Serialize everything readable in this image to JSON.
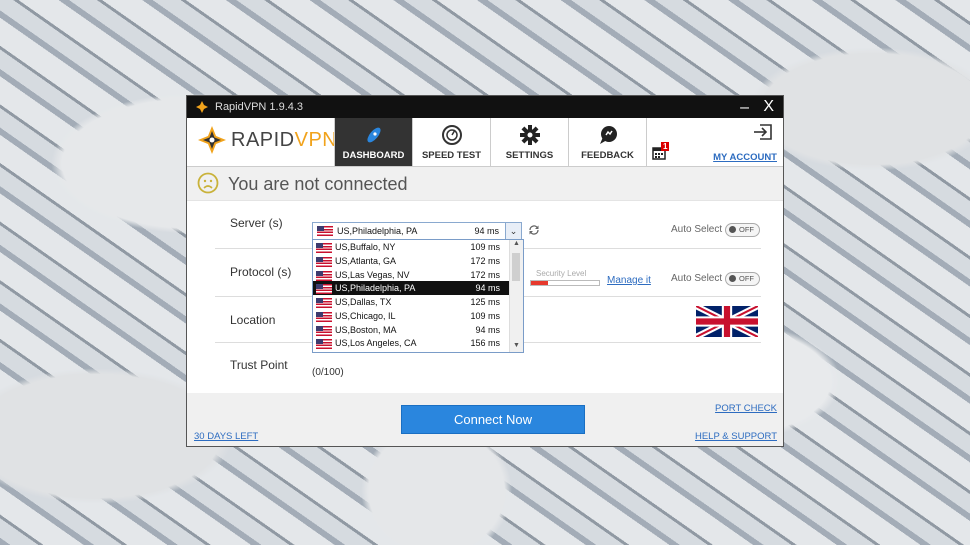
{
  "window": {
    "title": "RapidVPN 1.9.4.3",
    "minimize": "–",
    "close": "X"
  },
  "brand": {
    "part1": "RAPID",
    "part2": "VPN"
  },
  "nav": {
    "items": [
      {
        "label": "DASHBOARD",
        "icon": "rocket-icon",
        "active": true
      },
      {
        "label": "SPEED TEST",
        "icon": "speedometer-icon"
      },
      {
        "label": "SETTINGS",
        "icon": "gear-icon"
      },
      {
        "label": "FEEDBACK",
        "icon": "chat-bubble-icon"
      }
    ],
    "calendar_badge": "1",
    "my_account": "MY ACCOUNT"
  },
  "status": {
    "text": "You are not connected",
    "icon": "sad-face-icon"
  },
  "rows": {
    "server_label": "Server (s)",
    "protocol_label": "Protocol (s)",
    "location_label": "Location",
    "trust_label": "Trust Point",
    "trust_value": "(0/100)"
  },
  "server_select": {
    "name": "US,Philadelphia, PA",
    "ms": "94 ms"
  },
  "auto_select": {
    "label": "Auto Select",
    "state": "OFF"
  },
  "security": {
    "label": "Security Level",
    "level": 0.25,
    "manage": "Manage it"
  },
  "dropdown": {
    "items": [
      {
        "name": "US,Buffalo, NY",
        "ms": "109 ms"
      },
      {
        "name": "US,Atlanta, GA",
        "ms": "172 ms"
      },
      {
        "name": "US,Las Vegas, NV",
        "ms": "172 ms"
      },
      {
        "name": "US,Philadelphia, PA",
        "ms": "94 ms",
        "selected": true
      },
      {
        "name": "US,Dallas, TX",
        "ms": "125 ms"
      },
      {
        "name": "US,Chicago, IL",
        "ms": "109 ms"
      },
      {
        "name": "US,Boston, MA",
        "ms": "94 ms"
      },
      {
        "name": "US,Los Angeles, CA",
        "ms": "156 ms"
      }
    ]
  },
  "footer": {
    "connect": "Connect Now",
    "days_left": "30 DAYS LEFT",
    "port_check": "PORT CHECK",
    "help": "HELP & SUPPORT"
  },
  "colors": {
    "accent": "#2a86de",
    "brand_orange": "#f1a31c",
    "link": "#2d6cc0"
  }
}
